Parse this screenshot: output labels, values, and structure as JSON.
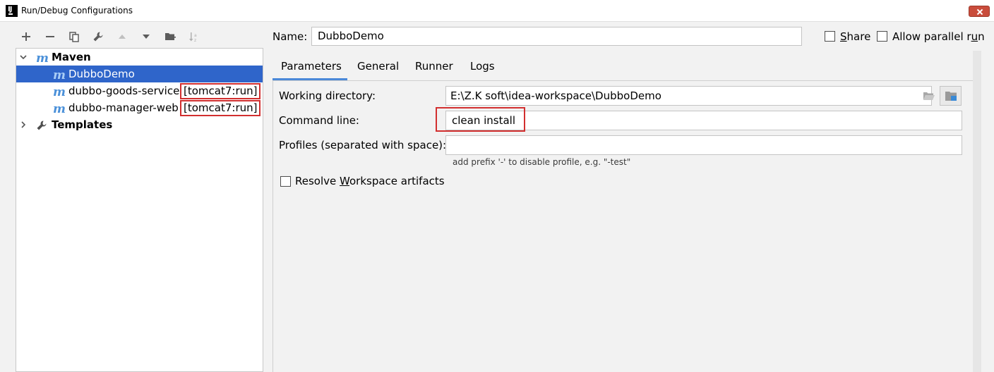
{
  "window": {
    "title": "Run/Debug Configurations",
    "app_icon": "intellij-icon",
    "app_icon_text": "IJ"
  },
  "toolbar": {
    "items": [
      "add-icon",
      "remove-icon",
      "copy-icon",
      "edit-defaults-icon",
      "move-up-icon",
      "move-down-icon",
      "new-folder-icon",
      "sort-icon"
    ]
  },
  "tree": {
    "maven_label": "Maven",
    "items": [
      {
        "label": "DubboDemo",
        "goal": "",
        "selected": true
      },
      {
        "label": "dubbo-goods-service",
        "goal": "[tomcat7:run]",
        "selected": false
      },
      {
        "label": "dubbo-manager-web",
        "goal": "[tomcat7:run]",
        "selected": false
      }
    ],
    "templates_label": "Templates",
    "maven_icon_glyph": "m"
  },
  "form": {
    "name_label": "Name:",
    "name_value": "DubboDemo",
    "share_label_pre": "",
    "share_label_ul": "S",
    "share_label_post": "hare",
    "parallel_label_pre": "Allow parallel r",
    "parallel_label_ul": "u",
    "parallel_label_post": "n"
  },
  "tabs": [
    "Parameters",
    "General",
    "Runner",
    "Logs"
  ],
  "parameters": {
    "working_dir_label": "Working directory:",
    "working_dir_value": "E:\\Z.K soft\\idea-workspace\\DubboDemo",
    "command_line_label": "Command line:",
    "command_line_value": "clean install",
    "profiles_label": "Profiles (separated with space):",
    "profiles_value": "",
    "profiles_hint": "add prefix '-' to disable profile, e.g. \"-test\"",
    "resolve_label_pre": "Resolve ",
    "resolve_label_ul": "W",
    "resolve_label_post": "orkspace artifacts"
  },
  "colors": {
    "selection": "#2f65ca",
    "highlight_box": "#d22f2f",
    "tab_underline": "#4a88d8",
    "maven_icon": "#4a90d9"
  }
}
